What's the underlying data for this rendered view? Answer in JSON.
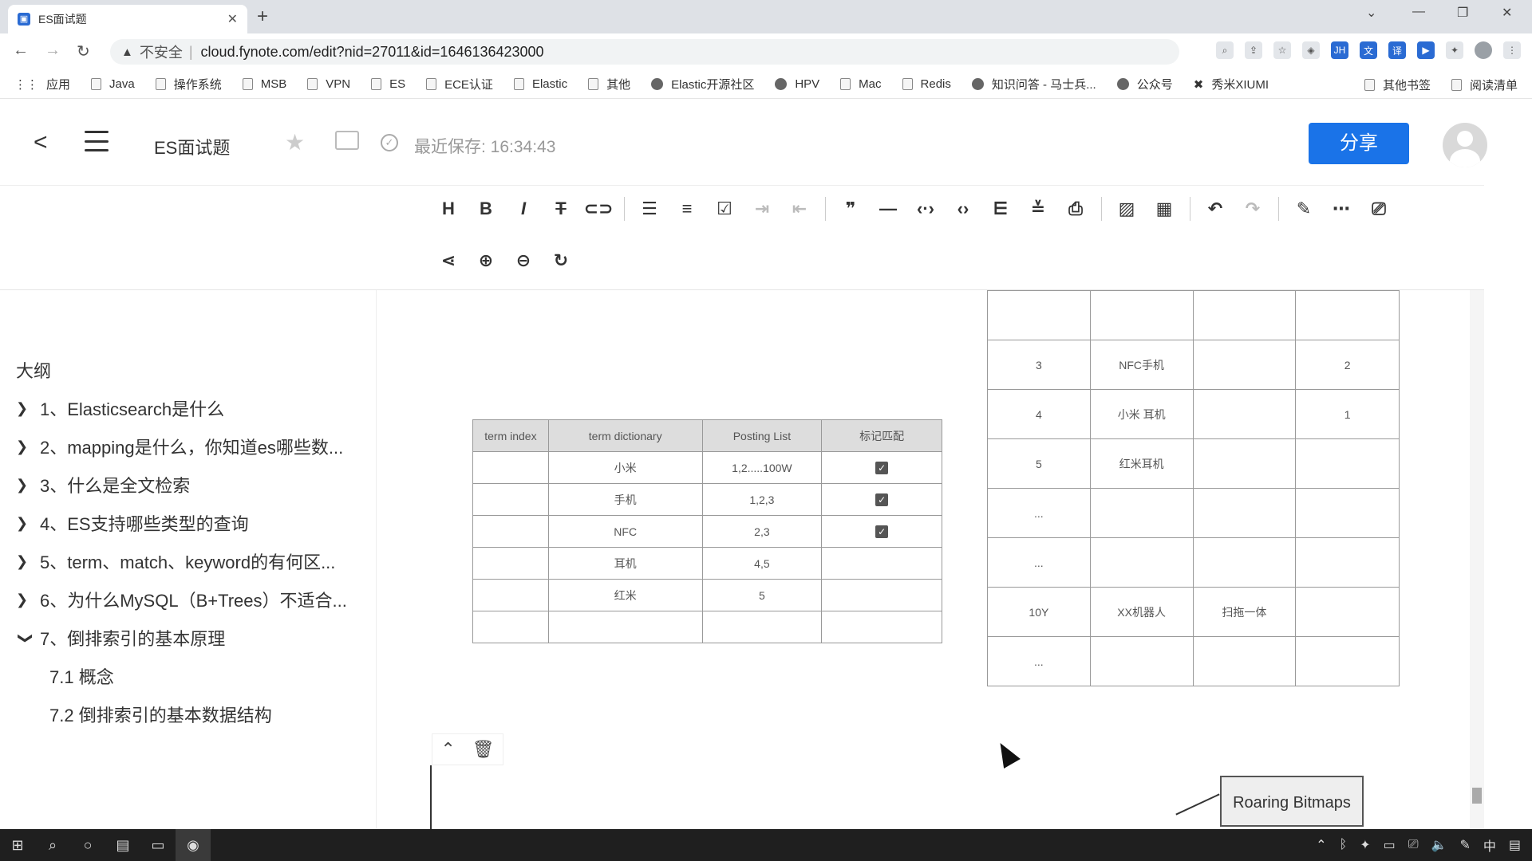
{
  "browser": {
    "tab_title": "ES面试题",
    "tab_close": "✕",
    "new_tab": "+",
    "insecure_label": "不安全",
    "url": "cloud.fynote.com/edit?nid=27011&id=1646136423000",
    "bookmarks": [
      "应用",
      "Java",
      "操作系统",
      "MSB",
      "VPN",
      "ES",
      "ECE认证",
      "Elastic",
      "其他",
      "Elastic开源社区",
      "HPV",
      "Mac",
      "Redis",
      "知识问答 - 马士兵...",
      "公众号",
      "秀米XIUMI"
    ],
    "bookmarks_right": [
      "其他书签",
      "阅读清单"
    ]
  },
  "header": {
    "doc_title": "ES面试题",
    "save_status": "最近保存: 16:34:43",
    "share_label": "分享"
  },
  "outline": {
    "title": "大纲",
    "items": [
      "1、Elasticsearch是什么",
      "2、mapping是什么，你知道es哪些数...",
      "3、什么是全文检索",
      "4、ES支持哪些类型的查询",
      "5、term、match、keyword的有何区...",
      "6、为什么MySQL（B+Trees）不适合...",
      "7、倒排索引的基本原理"
    ],
    "subitems": [
      "7.1 概念",
      "7.2 倒排索引的基本数据结构"
    ]
  },
  "table1": {
    "headers": [
      "term index",
      "term dictionary",
      "Posting List",
      "标记匹配"
    ],
    "rows": [
      [
        "",
        "小米",
        "1,2.....100W",
        "✓"
      ],
      [
        "",
        "手机",
        "1,2,3",
        "✓"
      ],
      [
        "",
        "NFC",
        "2,3",
        "✓"
      ],
      [
        "",
        "耳机",
        "4,5",
        ""
      ],
      [
        "",
        "红米",
        "5",
        ""
      ],
      [
        "",
        "",
        "",
        ""
      ]
    ]
  },
  "table2": {
    "rows": [
      [
        "3",
        "NFC手机",
        "",
        "2"
      ],
      [
        "4",
        "小米 耳机",
        "",
        "1"
      ],
      [
        "5",
        "红米耳机",
        "",
        ""
      ],
      [
        "...",
        "",
        "",
        ""
      ],
      [
        "...",
        "",
        "",
        ""
      ],
      [
        "10Y",
        "XX机器人",
        "扫拖一体",
        ""
      ],
      [
        "...",
        "",
        "",
        ""
      ]
    ]
  },
  "canvas": {
    "roaring_label": "Roaring Bitmaps"
  }
}
